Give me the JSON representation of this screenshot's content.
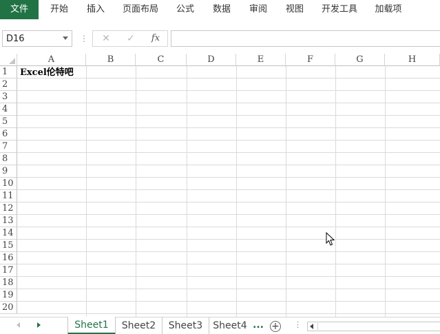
{
  "ribbon": {
    "tabs": [
      "文件",
      "开始",
      "插入",
      "页面布局",
      "公式",
      "数据",
      "审阅",
      "视图",
      "开发工具",
      "加载项"
    ]
  },
  "formula_bar": {
    "name_box": "D16",
    "cancel_icon": "✕",
    "enter_icon": "✓",
    "fx_label": "fx",
    "formula": ""
  },
  "grid": {
    "columns": [
      "A",
      "B",
      "C",
      "D",
      "E",
      "F",
      "G",
      "H"
    ],
    "rows": [
      "1",
      "2",
      "3",
      "4",
      "5",
      "6",
      "7",
      "8",
      "9",
      "10",
      "11",
      "12",
      "13",
      "14",
      "15",
      "16",
      "17",
      "18",
      "19",
      "20"
    ],
    "cells": {
      "A1": "Excel伦特吧"
    }
  },
  "sheets": {
    "tabs": [
      "Sheet1",
      "Sheet2",
      "Sheet3",
      "Sheet4"
    ],
    "active": "Sheet1",
    "more": "...",
    "add": "+"
  },
  "colors": {
    "accent": "#217346",
    "gridline": "#dadada"
  }
}
